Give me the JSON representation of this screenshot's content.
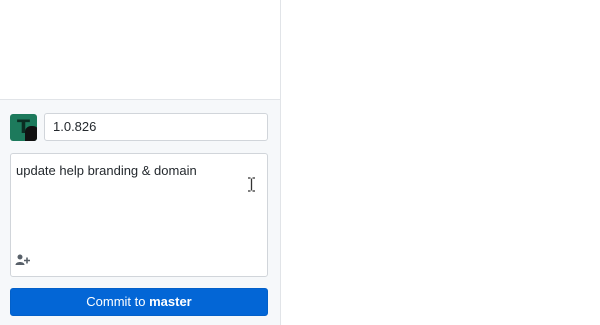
{
  "commit_form": {
    "summary_value": "1.0.826",
    "description_value": "update help branding & domain",
    "commit_button_prefix": "Commit to ",
    "commit_button_branch": "master",
    "avatar_initial": "T"
  },
  "icons": {
    "avatar": "user-avatar",
    "coauthor": "add-coauthor-icon",
    "cursor": "text-cursor-icon"
  },
  "colors": {
    "accent": "#0366d6",
    "avatar_bg": "#1d7a5c",
    "panel_bg": "#f6f8fa",
    "border": "#d1d5da"
  }
}
